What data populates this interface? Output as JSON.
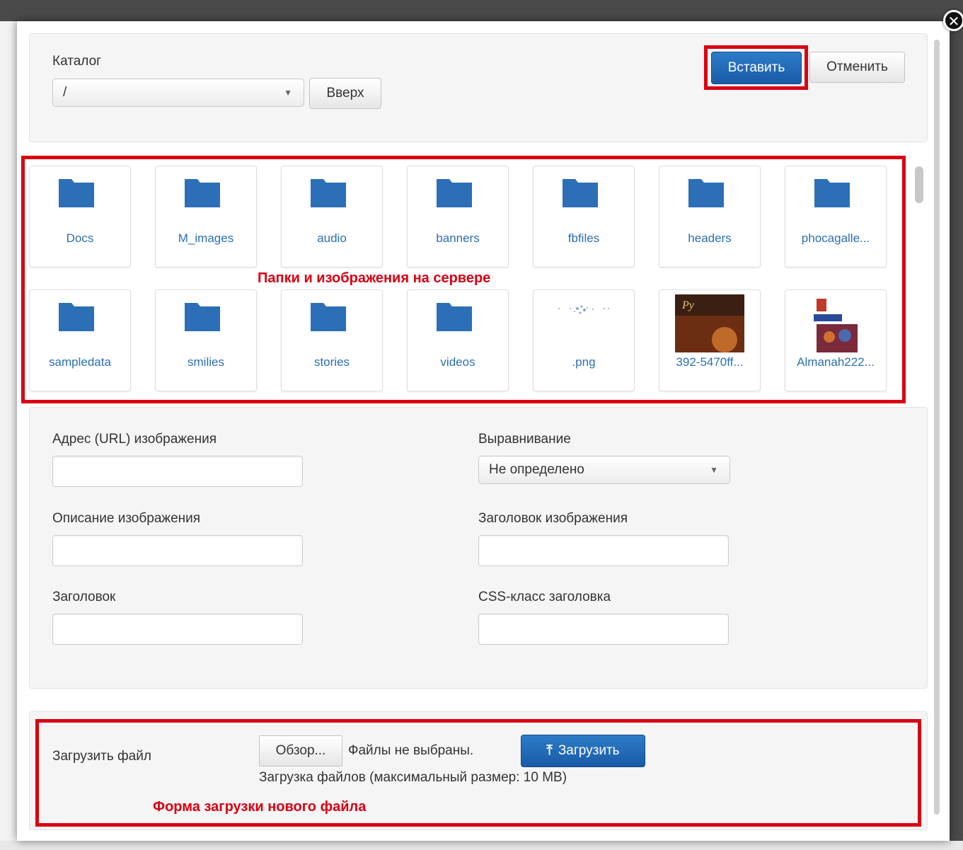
{
  "dialog": {
    "close_glyph": "✕",
    "catalog_label": "Каталог",
    "catalog_value": "/",
    "up_button": "Вверх",
    "insert_button": "Вставить",
    "cancel_button": "Отменить"
  },
  "browser": {
    "annotation": "Папки и изображения на сервере",
    "items": [
      {
        "name": "Docs",
        "type": "folder"
      },
      {
        "name": "M_images",
        "type": "folder"
      },
      {
        "name": "audio",
        "type": "folder"
      },
      {
        "name": "banners",
        "type": "folder"
      },
      {
        "name": "fbfiles",
        "type": "folder"
      },
      {
        "name": "headers",
        "type": "folder"
      },
      {
        "name": "phocagalle...",
        "type": "folder"
      },
      {
        "name": "sampledata",
        "type": "folder"
      },
      {
        "name": "smilies",
        "type": "folder"
      },
      {
        "name": "stories",
        "type": "folder"
      },
      {
        "name": "videos",
        "type": "folder"
      },
      {
        "name": ".png",
        "type": "image"
      },
      {
        "name": "392-5470ff...",
        "type": "image"
      },
      {
        "name": "Almanah222...",
        "type": "image"
      }
    ]
  },
  "form": {
    "url_label": "Адрес (URL) изображения",
    "align_label": "Выравнивание",
    "align_value": "Не определено",
    "description_label": "Описание изображения",
    "image_title_label": "Заголовок изображения",
    "caption_label": "Заголовок",
    "caption_css_label": "CSS-класс заголовка"
  },
  "upload": {
    "label": "Загрузить файл",
    "browse_button": "Обзор...",
    "no_file_text": "Файлы не выбраны.",
    "upload_button": "Загрузить",
    "hint": "Загрузка файлов (максимальный размер: 10 MB)",
    "annotation": "Форма загрузки нового файла"
  },
  "colors": {
    "accent": "#1a5aa6",
    "annotation_red": "#d90012",
    "folder_blue": "#2c6fb7",
    "link_blue": "#2a6fb5"
  }
}
